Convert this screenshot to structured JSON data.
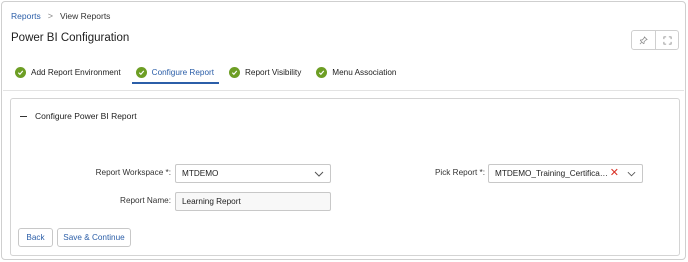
{
  "breadcrumb": {
    "root": "Reports",
    "separator": ">",
    "current": "View Reports"
  },
  "page": {
    "title": "Power BI Configuration"
  },
  "window_buttons": {
    "pin_icon": "pin-icon",
    "expand_icon": "expand-icon"
  },
  "tabs": [
    {
      "label": "Add Report Environment",
      "completed": true,
      "active": false
    },
    {
      "label": "Configure Report",
      "completed": true,
      "active": true
    },
    {
      "label": "Report Visibility",
      "completed": true,
      "active": false
    },
    {
      "label": "Menu Association",
      "completed": true,
      "active": false
    }
  ],
  "section": {
    "title": "Configure Power BI Report"
  },
  "form": {
    "workspace_label": "Report Workspace *:",
    "workspace_value": "MTDEMO",
    "pick_report_label": "Pick Report *:",
    "pick_report_value": "MTDEMO_Training_Certificate_e...",
    "report_name_label": "Report Name:",
    "report_name_value": "Learning Report"
  },
  "actions": {
    "back": "Back",
    "save_continue": "Save & Continue"
  },
  "colors": {
    "accent": "#2b5ea8",
    "success": "#6d9e24",
    "danger": "#d93025"
  }
}
